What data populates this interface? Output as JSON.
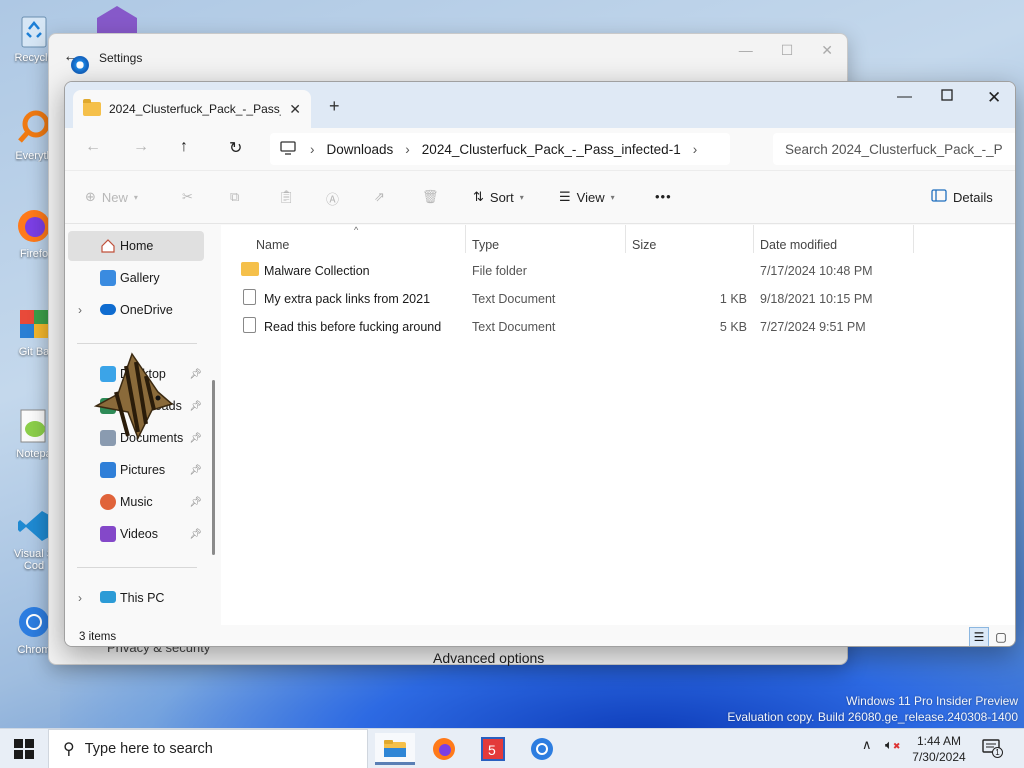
{
  "desktop": {
    "icons": [
      {
        "label": "Recycle",
        "icon": "recycle-bin-icon"
      },
      {
        "label": "Everyth",
        "icon": "everything-search-icon"
      },
      {
        "label": "Firefo",
        "icon": "firefox-icon"
      },
      {
        "label": "Git Ba",
        "icon": "git-bash-icon"
      },
      {
        "label": "Notepa",
        "icon": "notepad-plus-icon"
      },
      {
        "label": "Visual S",
        "label2": "Cod",
        "icon": "vscode-icon"
      },
      {
        "label": "Chrom",
        "icon": "chromium-icon"
      }
    ],
    "watermark_line1": "Windows 11 Pro Insider Preview",
    "watermark_line2": "Evaluation copy. Build 26080.ge_release.240308-1400"
  },
  "settings_window": {
    "title": "Settings",
    "footer_left": "Privacy & security",
    "footer_mid": "Advanced options"
  },
  "explorer": {
    "tab_title": "2024_Clusterfuck_Pack_-_Pass_",
    "breadcrumb": [
      "Downloads",
      "2024_Clusterfuck_Pack_-_Pass_infected-1"
    ],
    "search_placeholder": "Search 2024_Clusterfuck_Pack_-_P",
    "toolbar": {
      "new_label": "New",
      "sort_label": "Sort",
      "view_label": "View",
      "more_label": "•••",
      "details_label": "Details"
    },
    "sidebar": {
      "items": [
        {
          "label": "Home",
          "icon": "home-icon"
        },
        {
          "label": "Gallery",
          "icon": "gallery-icon"
        },
        {
          "label": "OneDrive",
          "icon": "onedrive-icon"
        },
        {
          "label": "Desktop",
          "icon": "desktop-icon"
        },
        {
          "label": "Downloads",
          "icon": "downloads-icon"
        },
        {
          "label": "Documents",
          "icon": "documents-icon"
        },
        {
          "label": "Pictures",
          "icon": "pictures-icon"
        },
        {
          "label": "Music",
          "icon": "music-icon"
        },
        {
          "label": "Videos",
          "icon": "videos-icon"
        },
        {
          "label": "This PC",
          "icon": "this-pc-icon"
        }
      ]
    },
    "columns": [
      "Name",
      "Type",
      "Size",
      "Date modified"
    ],
    "files": [
      {
        "name": "Malware Collection",
        "type": "File folder",
        "size": "",
        "date": "7/17/2024 10:48 PM",
        "kind": "folder"
      },
      {
        "name": "My extra pack links from 2021",
        "type": "Text Document",
        "size": "1 KB",
        "date": "9/18/2021 10:15 PM",
        "kind": "doc"
      },
      {
        "name": "Read this before fucking around",
        "type": "Text Document",
        "size": "5 KB",
        "date": "7/27/2024 9:51 PM",
        "kind": "doc"
      }
    ],
    "status": "3 items"
  },
  "taskbar": {
    "search_placeholder": "Type here to search",
    "time": "1:44 AM",
    "date": "7/30/2024",
    "notification_count": "1",
    "apps": [
      {
        "name": "file-explorer",
        "active": true
      },
      {
        "name": "firefox",
        "active": false
      },
      {
        "name": "resource-hacker",
        "active": false
      },
      {
        "name": "chromium",
        "active": false
      }
    ]
  },
  "colors": {
    "accent": "#0067c0",
    "folder": "#f5c04a",
    "titlebar": "#dfe9f5"
  }
}
